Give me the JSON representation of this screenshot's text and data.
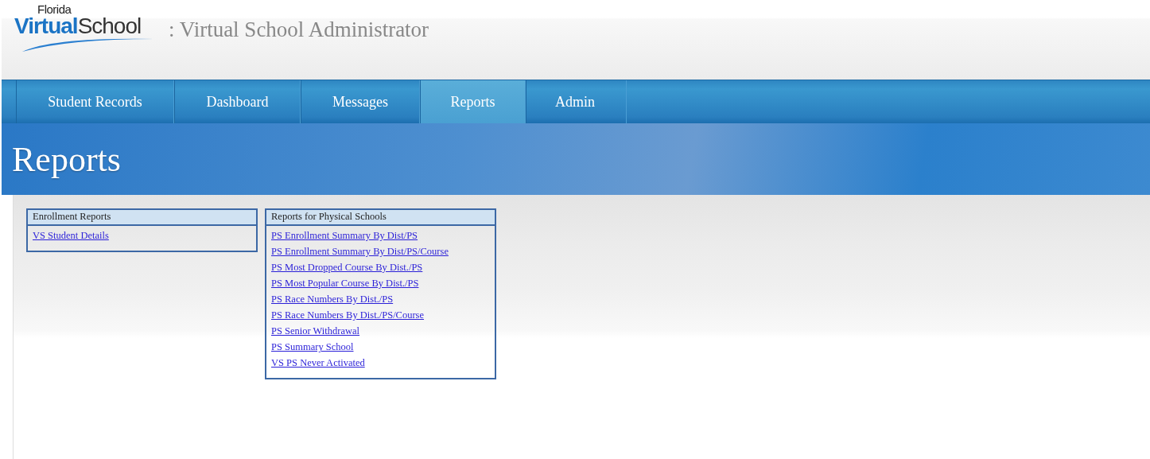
{
  "logo": {
    "line_1": "Florida",
    "line_2": "**Virtual**School"
  },
  "app_title": ": Virtual School Administrator",
  "tabs": [
    {
      "label": "Student Records",
      "selected": false
    },
    {
      "label": "Dashboard",
      "selected": false
    },
    {
      "label": "Messages",
      "selected": false
    },
    {
      "label": "Reports",
      "selected": true
    },
    {
      "label": "Admin",
      "selected": false
    }
  ],
  "page_title": "Reports",
  "panels": [
    {
      "title": "Enrollment Reports",
      "links": [
        "VS Student Details"
      ]
    },
    {
      "title": "Reports for Physical Schools",
      "links": [
        "PS Enrollment Summary By Dist/PS",
        "PS Enrollment Summary By Dist/PS/Course",
        "PS Most Dropped Course By Dist./PS",
        "PS Most Popular Course By Dist./PS",
        "PS Race Numbers By Dist./PS",
        "PS Race Numbers By Dist./PS/Course",
        "PS Senior Withdrawal",
        "PS Summary School",
        "VS PS Never Activated"
      ]
    }
  ]
}
